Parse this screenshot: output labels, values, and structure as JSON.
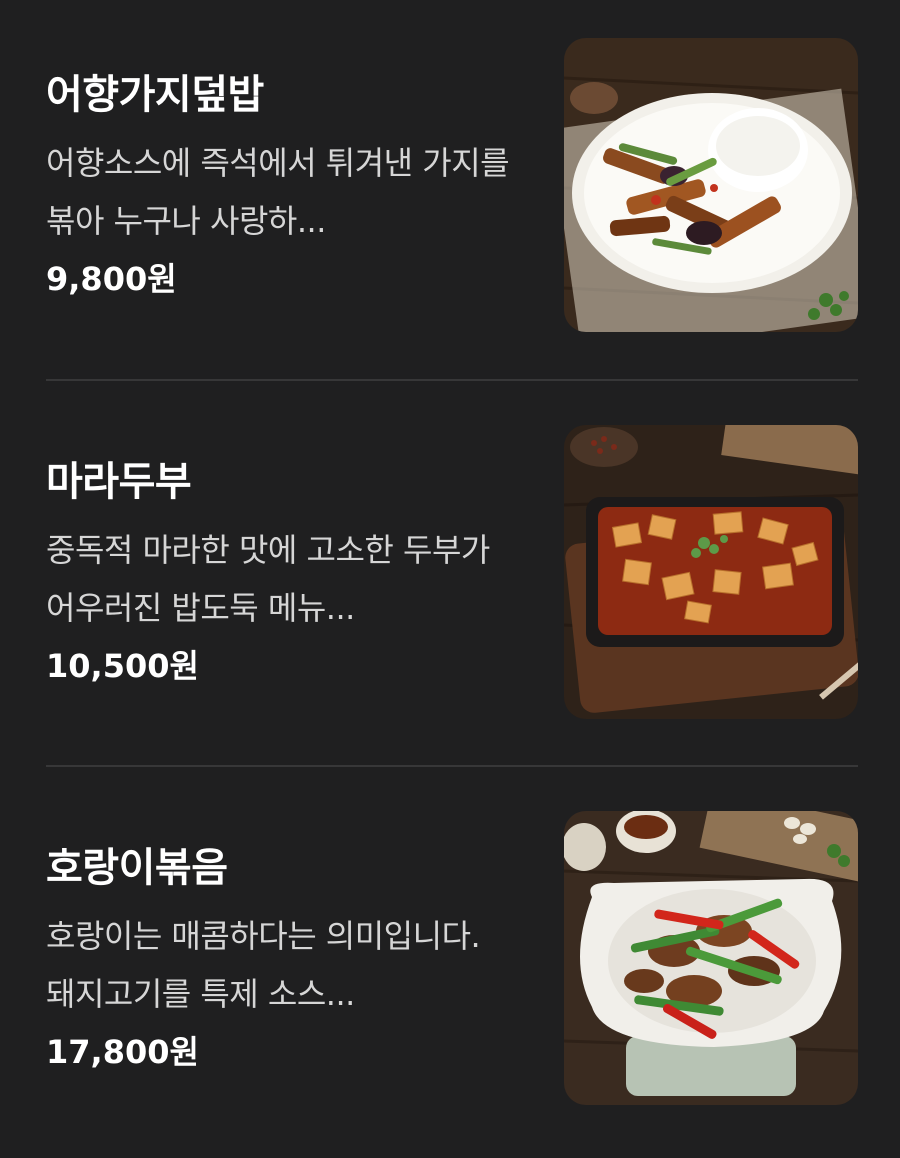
{
  "menu": {
    "items": [
      {
        "name": "어향가지덮밥",
        "description": "어향소스에 즉석에서 튀겨낸 가지를 볶아 누구나 사랑하...",
        "price": "9,800원",
        "image_icon": "eggplant-rice-dish-photo"
      },
      {
        "name": "마라두부",
        "description": "중독적 마라한 맛에 고소한 두부가 어우러진 밥도둑 메뉴...",
        "price": "10,500원",
        "image_icon": "mala-tofu-dish-photo"
      },
      {
        "name": "호랑이볶음",
        "description": "호랑이는 매콤하다는 의미입니다. 돼지고기를 특제 소스...",
        "price": "17,800원",
        "image_icon": "tiger-stir-fry-dish-photo"
      }
    ]
  },
  "colors": {
    "background": "#1f1f20",
    "divider": "#373738",
    "text_primary": "#ffffff",
    "text_secondary": "#d6d6d6"
  }
}
